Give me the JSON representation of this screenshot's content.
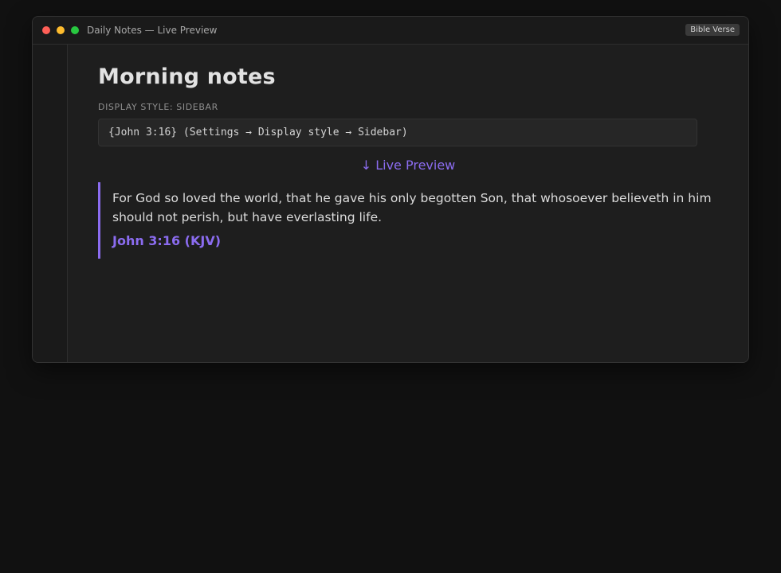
{
  "window": {
    "title": "Daily Notes — Live Preview",
    "plugin_badge": "Bible Verse"
  },
  "note": {
    "title": "Morning notes",
    "section_label": "DISPLAY STYLE: SIDEBAR",
    "code": "{John 3:16} (Settings → Display style → Sidebar)",
    "live_preview_label": "↓ Live Preview"
  },
  "verse": {
    "text": "For God so loved the world, that he gave his only begotten Son, that whosoever believeth in him should not perish, but have everlasting life.",
    "reference": "John 3:16 (KJV)"
  },
  "colors": {
    "accent": "#8b6cf0",
    "background": "#111111",
    "window": "#1e1e1e",
    "close": "#ff5f57",
    "minimize": "#febc2e",
    "maximize": "#28c840"
  }
}
